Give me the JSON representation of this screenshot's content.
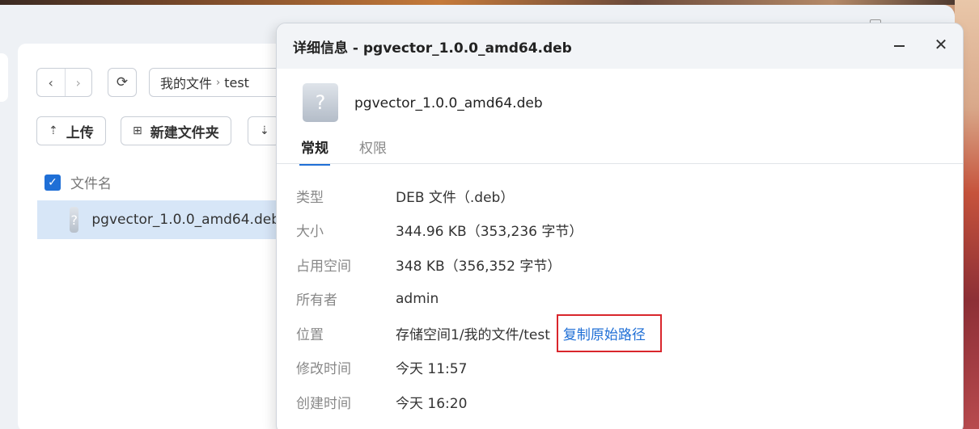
{
  "file_manager": {
    "breadcrumb": {
      "root": "我的文件",
      "separator": "›",
      "current": "test"
    },
    "toolbar": {
      "upload_label": "上传",
      "new_folder_label": "新建文件夹"
    },
    "list": {
      "column_name": "文件名",
      "rows": [
        {
          "name": "pgvector_1.0.0_amd64.deb"
        }
      ]
    }
  },
  "dialog": {
    "title": "详细信息 - pgvector_1.0.0_amd64.deb",
    "close_glyph": "✕",
    "file_name": "pgvector_1.0.0_amd64.deb",
    "icon_glyph": "?",
    "tabs": [
      {
        "label": "常规",
        "active": true
      },
      {
        "label": "权限",
        "active": false
      }
    ],
    "properties": [
      {
        "label": "类型",
        "value": "DEB 文件（.deb）"
      },
      {
        "label": "大小",
        "value": "344.96 KB（353,236 字节）"
      },
      {
        "label": "占用空间",
        "value": "348 KB（356,352 字节）"
      },
      {
        "label": "所有者",
        "value": "admin"
      },
      {
        "label": "位置",
        "value": "存储空间1/我的文件/test",
        "action": "复制原始路径"
      },
      {
        "label": "修改时间",
        "value": "今天 11:57"
      },
      {
        "label": "创建时间",
        "value": "今天 16:20"
      }
    ]
  },
  "colors": {
    "accent": "#1f6fd6",
    "highlight_box": "#d9262c",
    "selected_row": "#d7e6f7"
  }
}
